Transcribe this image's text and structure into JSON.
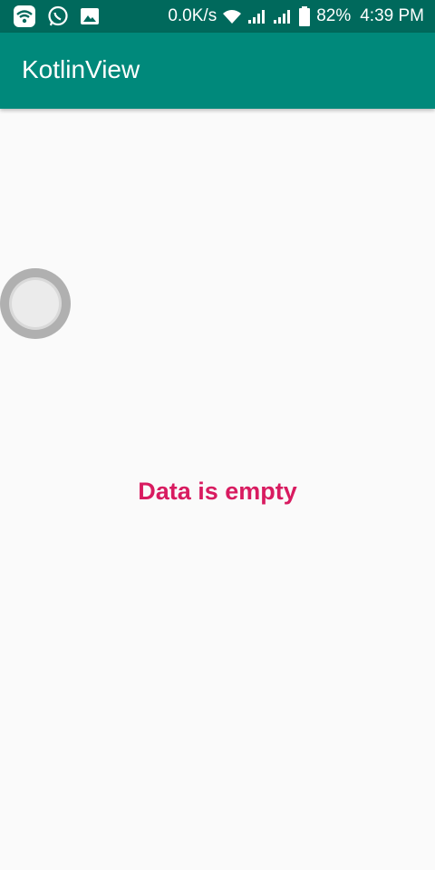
{
  "status_bar": {
    "icons_left": [
      "wifi-hotspot-icon",
      "whatsapp-icon",
      "gallery-icon"
    ],
    "net_speed": "0.0K/s",
    "battery_percent": "82%",
    "time": "4:39 PM"
  },
  "app_bar": {
    "title": "KotlinView",
    "color": "#00897b"
  },
  "main": {
    "empty_message": "Data is empty",
    "empty_message_color": "#d81b60"
  }
}
